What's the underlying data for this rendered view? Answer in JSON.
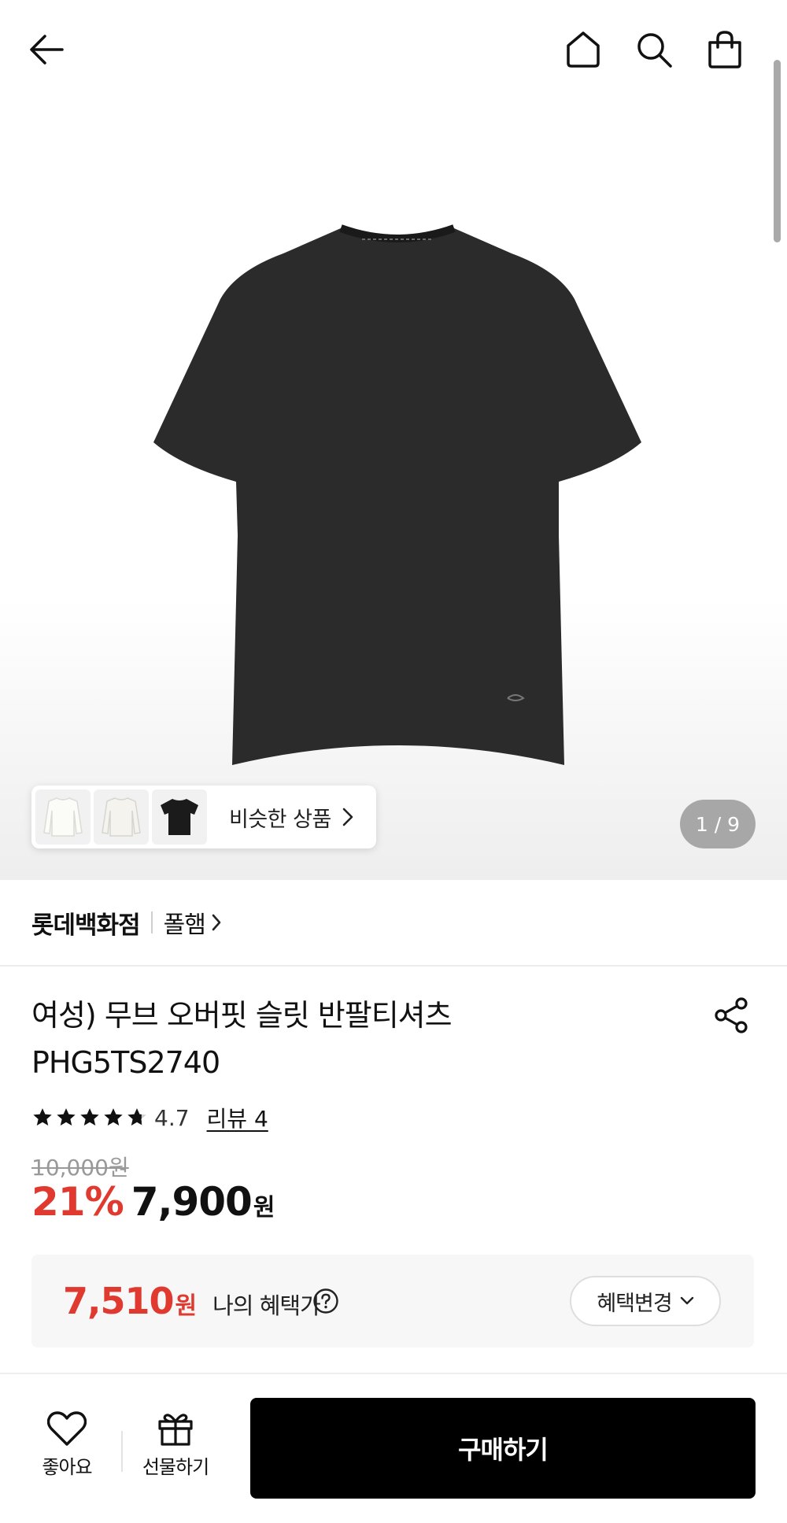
{
  "gallery": {
    "similar_label": "비슷한 상품",
    "page_counter": "1 / 9",
    "thumbnails": [
      "white-longsleeve-thumb",
      "white-longsleeve-thumb",
      "black-tshirt-thumb"
    ]
  },
  "brand": {
    "store": "롯데백화점",
    "name": "폴햄"
  },
  "product": {
    "title_line1": "여성) 무브 오버핏 슬릿 반팔티셔츠",
    "title_line2": "PHG5TS2740",
    "rating": 4.7,
    "rating_text": "4.7",
    "review_link": "리뷰 4",
    "original_price": "10,000원",
    "discount_rate": "21%",
    "sale_price": "7,900",
    "sale_unit": "원"
  },
  "benefit": {
    "amount": "7,510",
    "unit": "원",
    "label": "나의 혜택가",
    "change_button": "혜택변경"
  },
  "bottom_bar": {
    "like_label": "좋아요",
    "gift_label": "선물하기",
    "buy_label": "구매하기"
  },
  "colors": {
    "accent_red": "#e0392f",
    "buy_button": "#000000",
    "product_color": "#2b2b2b"
  }
}
